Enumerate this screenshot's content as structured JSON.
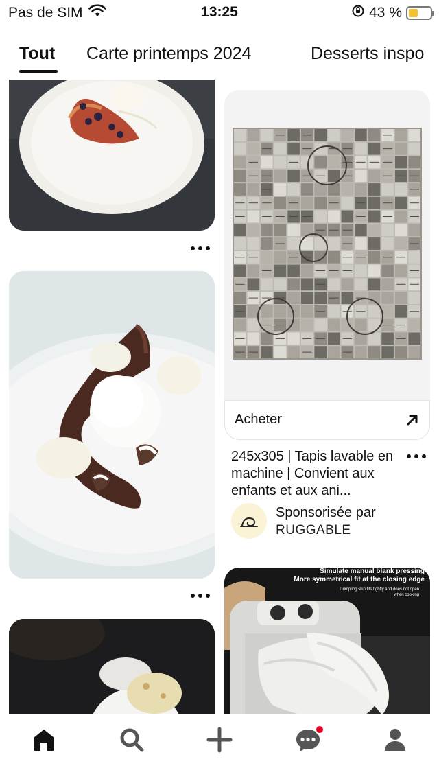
{
  "status_bar": {
    "carrier": "Pas de SIM",
    "time": "13:25",
    "battery_text": "43 %",
    "battery_level": 0.43,
    "icons": [
      "wifi-icon",
      "rotation-lock-icon",
      "battery-icon"
    ]
  },
  "tabs": [
    {
      "label": "Tout",
      "selected": true
    },
    {
      "label": "Carte printemps 2024",
      "selected": false
    },
    {
      "label": "Desserts inspo",
      "selected": false
    }
  ],
  "sponsored_pin": {
    "cta_label": "Acheter",
    "cta_icon": "arrow-up-right-icon",
    "title": "245x305 | Tapis lavable en machine | Convient aux enfants et aux ani...",
    "sponsored_label": "Sponsorisée par",
    "advertiser": "RUGGABLE"
  },
  "dumpling_ad": {
    "headline_1": "Simulate manual blank pressing",
    "headline_2": "More symmetrical fit at the closing edge",
    "subtext": "Dumpling skin fits tightly and does not open when cooking"
  },
  "bottom_nav": {
    "items": [
      {
        "name": "home",
        "icon": "home-icon",
        "active": true
      },
      {
        "name": "search",
        "icon": "search-icon",
        "active": false
      },
      {
        "name": "create",
        "icon": "plus-icon",
        "active": false
      },
      {
        "name": "messages",
        "icon": "chat-icon",
        "active": false,
        "has_notification": true
      },
      {
        "name": "profile",
        "icon": "profile-icon",
        "active": false
      }
    ]
  },
  "colors": {
    "notification": "#e60023",
    "battery": "#f2c230",
    "text": "#111111"
  }
}
